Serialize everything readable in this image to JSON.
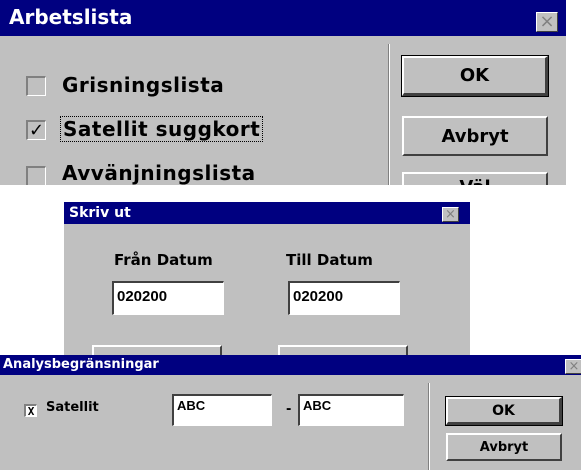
{
  "arbetslista": {
    "title": "Arbetslista",
    "close_glyph": "×",
    "items": [
      {
        "label": "Grisningslista",
        "checked": false
      },
      {
        "label": "Satellit suggkort",
        "checked": true,
        "mark": "✓"
      },
      {
        "label": "Avvänjningslista",
        "checked": false
      }
    ],
    "ok_label": "OK",
    "cancel_label": "Avbryt",
    "partial_label": "Väl"
  },
  "skriv_ut": {
    "title": "Skriv ut",
    "close_glyph": "×",
    "from_label": "Från Datum",
    "to_label": "Till Datum",
    "from_value": "020200",
    "to_value": "020200"
  },
  "analys": {
    "title": "Analysbegränsningar",
    "close_glyph": "×",
    "checkbox_mark": "X",
    "satellit_label": "Satellit",
    "from_value": "ABC",
    "dash": "-",
    "to_value": "ABC",
    "ok_label": "OK",
    "cancel_label": "Avbryt"
  }
}
